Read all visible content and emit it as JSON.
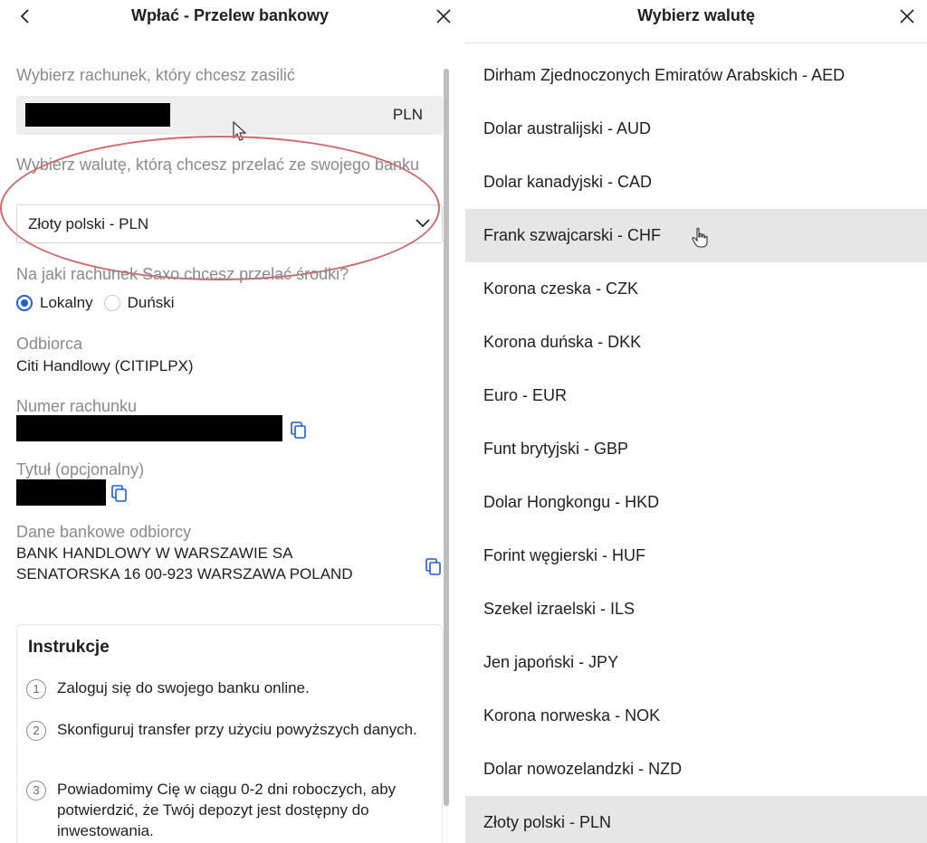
{
  "deposit": {
    "title": "Wpłać - Przelew bankowy",
    "account_label": "Wybierz rachunek, który chcesz zasilić",
    "account_currency": "PLN",
    "currency_label": "Wybierz walutę, którą chcesz przelać ze swojego banku",
    "currency_value": "Złoty polski - PLN",
    "target_label": "Na jaki rachunek Saxo chcesz przelać środki?",
    "radio_options": [
      {
        "label": "Lokalny",
        "selected": true
      },
      {
        "label": "Duński",
        "selected": false
      }
    ],
    "recipient_label": "Odbiorca",
    "recipient_value": "Citi Handlowy (CITIPLPX)",
    "account_number_label": "Numer rachunku",
    "title_label": "Tytuł (opcjonalny)",
    "bank_details_label": "Dane bankowe odbiorcy",
    "bank_details_line1": "BANK HANDLOWY W WARSZAWIE SA",
    "bank_details_line2": "SENATORSKA 16 00-923 WARSZAWA POLAND",
    "instructions": {
      "title": "Instrukcje",
      "steps": [
        {
          "num": "1",
          "text": "Zaloguj się do swojego banku online."
        },
        {
          "num": "2",
          "text": "Skonfiguruj transfer przy użyciu powyższych danych."
        },
        {
          "num": "3",
          "text": "Powiadomimy Cię w ciągu 0-2 dni roboczych, aby potwierdzić, że Twój depozyt jest dostępny do inwestowania."
        }
      ]
    }
  },
  "currency_picker": {
    "title": "Wybierz walutę",
    "items": [
      {
        "label": "Dirham Zjednoczonych Emiratów Arabskich - AED",
        "state": "normal"
      },
      {
        "label": "Dolar australijski - AUD",
        "state": "normal"
      },
      {
        "label": "Dolar kanadyjski - CAD",
        "state": "normal"
      },
      {
        "label": "Frank szwajcarski - CHF",
        "state": "hover"
      },
      {
        "label": "Korona czeska - CZK",
        "state": "normal"
      },
      {
        "label": "Korona duńska - DKK",
        "state": "normal"
      },
      {
        "label": "Euro - EUR",
        "state": "normal"
      },
      {
        "label": "Funt brytyjski - GBP",
        "state": "normal"
      },
      {
        "label": "Dolar Hongkongu - HKD",
        "state": "normal"
      },
      {
        "label": "Forint węgierski - HUF",
        "state": "normal"
      },
      {
        "label": "Szekel izraelski - ILS",
        "state": "normal"
      },
      {
        "label": "Jen japoński - JPY",
        "state": "normal"
      },
      {
        "label": "Korona norweska - NOK",
        "state": "normal"
      },
      {
        "label": "Dolar nowozelandzki - NZD",
        "state": "normal"
      },
      {
        "label": "Złoty polski - PLN",
        "state": "selected"
      }
    ]
  },
  "colors": {
    "accent": "#1c5fd6",
    "annotation": "#d06a6a",
    "highlight_row": "#e6e6e6",
    "muted_text": "#8a8a8a"
  },
  "icons": {
    "back": "chevron-left-icon",
    "close": "close-icon",
    "dropdown": "chevron-down-icon",
    "copy": "copy-icon",
    "pointer": "hand-pointer-icon"
  }
}
